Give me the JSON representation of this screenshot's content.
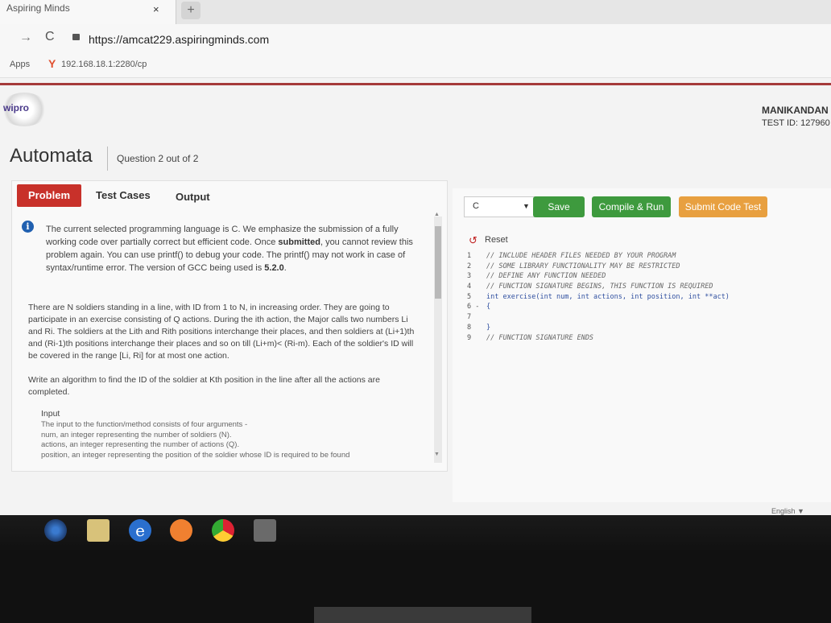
{
  "browser": {
    "tab_title": "Aspiring Minds",
    "tab_close": "×",
    "new_tab": "+",
    "back_glyph": "→",
    "reload_glyph": "C",
    "url": "https://amcat229.aspiringminds.com",
    "bookmarks_apps": "Apps",
    "bookmark_link": "192.168.18.1:2280/cp"
  },
  "header": {
    "logo_text": "wipro",
    "user_name": "MANIKANDAN",
    "test_id": "TEST ID: 127960"
  },
  "app": {
    "title": "Automata",
    "question_count": "Question 2 out of 2"
  },
  "tabs": {
    "problem": "Problem",
    "test_cases": "Test Cases",
    "output": "Output"
  },
  "problem": {
    "info_icon": "i",
    "info_1": "The current selected programming language is C. We emphasize the submission of a fully working code over partially correct but efficient code. Once ",
    "info_bold_1": "submitted",
    "info_2": ", you cannot review this problem again. You can use printf() to debug your code. The printf() may not work in case of syntax/runtime error. The version of GCC being used is ",
    "info_bold_2": "5.2.0",
    "info_3": ".",
    "statement": "There are N soldiers standing in a line, with ID from 1 to N, in increasing order. They are going to participate in an exercise consisting of Q actions. During the ith action, the Major calls two numbers Li and Ri. The soldiers at the Lith and Rith positions interchange their places, and then soldiers at (Li+1)th and (Ri-1)th positions interchange their places and so on till (Li+m)< (Ri-m). Each of the soldier's ID will be covered in the range [Li, Ri] for at most one action.",
    "task": "Write an algorithm to find the ID of the soldier at Kth position in the line after all the actions are completed.",
    "input_heading": "Input",
    "input_desc": [
      "The input to the function/method consists of four arguments -",
      "num, an integer representing the number of soldiers (N).",
      "actions, an integer representing the number of actions (Q).",
      "position, an integer representing the position of the soldier whose ID is required to be found"
    ]
  },
  "editor": {
    "language": "C",
    "dropdown_glyph": "▼",
    "save": "Save",
    "compile_run": "Compile & Run",
    "submit": "Submit Code Test",
    "reset_icon": "↺",
    "reset": "Reset",
    "code_lines": [
      {
        "num": "1",
        "text": "// INCLUDE HEADER FILES NEEDED BY YOUR PROGRAM",
        "kind": "comment"
      },
      {
        "num": "2",
        "text": "// SOME LIBRARY FUNCTIONALITY MAY BE RESTRICTED",
        "kind": "comment"
      },
      {
        "num": "3",
        "text": "// DEFINE ANY FUNCTION NEEDED",
        "kind": "comment"
      },
      {
        "num": "4",
        "text": "// FUNCTION SIGNATURE BEGINS, THIS FUNCTION IS REQUIRED",
        "kind": "comment"
      },
      {
        "num": "5",
        "text": "int exercise(int num, int actions, int position, int **act)",
        "kind": "code"
      },
      {
        "num": "6 -",
        "text": "{",
        "kind": "code"
      },
      {
        "num": "7",
        "text": "",
        "kind": "code"
      },
      {
        "num": "8",
        "text": "}",
        "kind": "code"
      },
      {
        "num": "9",
        "text": "// FUNCTION SIGNATURE ENDS",
        "kind": "comment"
      }
    ],
    "footer_language": "English ▼"
  },
  "colors": {
    "problem_tab": "#c8312a",
    "save": "#3e9a3e",
    "compile": "#3e9a3e",
    "submit": "#e8a040",
    "accent_line": "#a53a3a"
  },
  "taskbar_icons": [
    "start-orb-icon",
    "folder-icon",
    "internet-explorer-icon",
    "media-player-icon",
    "chrome-icon",
    "paint-icon"
  ]
}
